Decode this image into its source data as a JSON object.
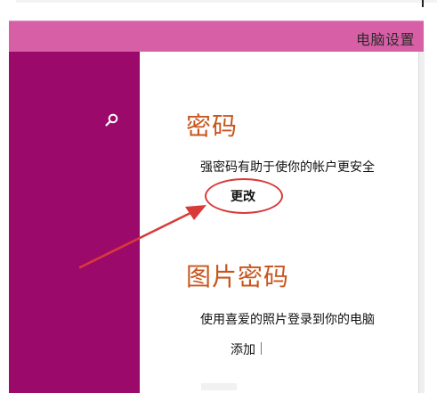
{
  "window": {
    "title": "电脑设置"
  },
  "sidebar": {
    "search_icon": "search-icon"
  },
  "password_section": {
    "title": "密码",
    "description": "强密码有助于使你的帐户更安全",
    "button_label": "更改"
  },
  "picture_password_section": {
    "title": "图片密码",
    "description": "使用喜爱的照片登录到你的电脑",
    "button_label": "添加"
  },
  "colors": {
    "titlebar": "#d75fa6",
    "sidebar": "#9b0a6a",
    "section_title": "#c7561e",
    "annotation_red": "#d83a3a"
  }
}
